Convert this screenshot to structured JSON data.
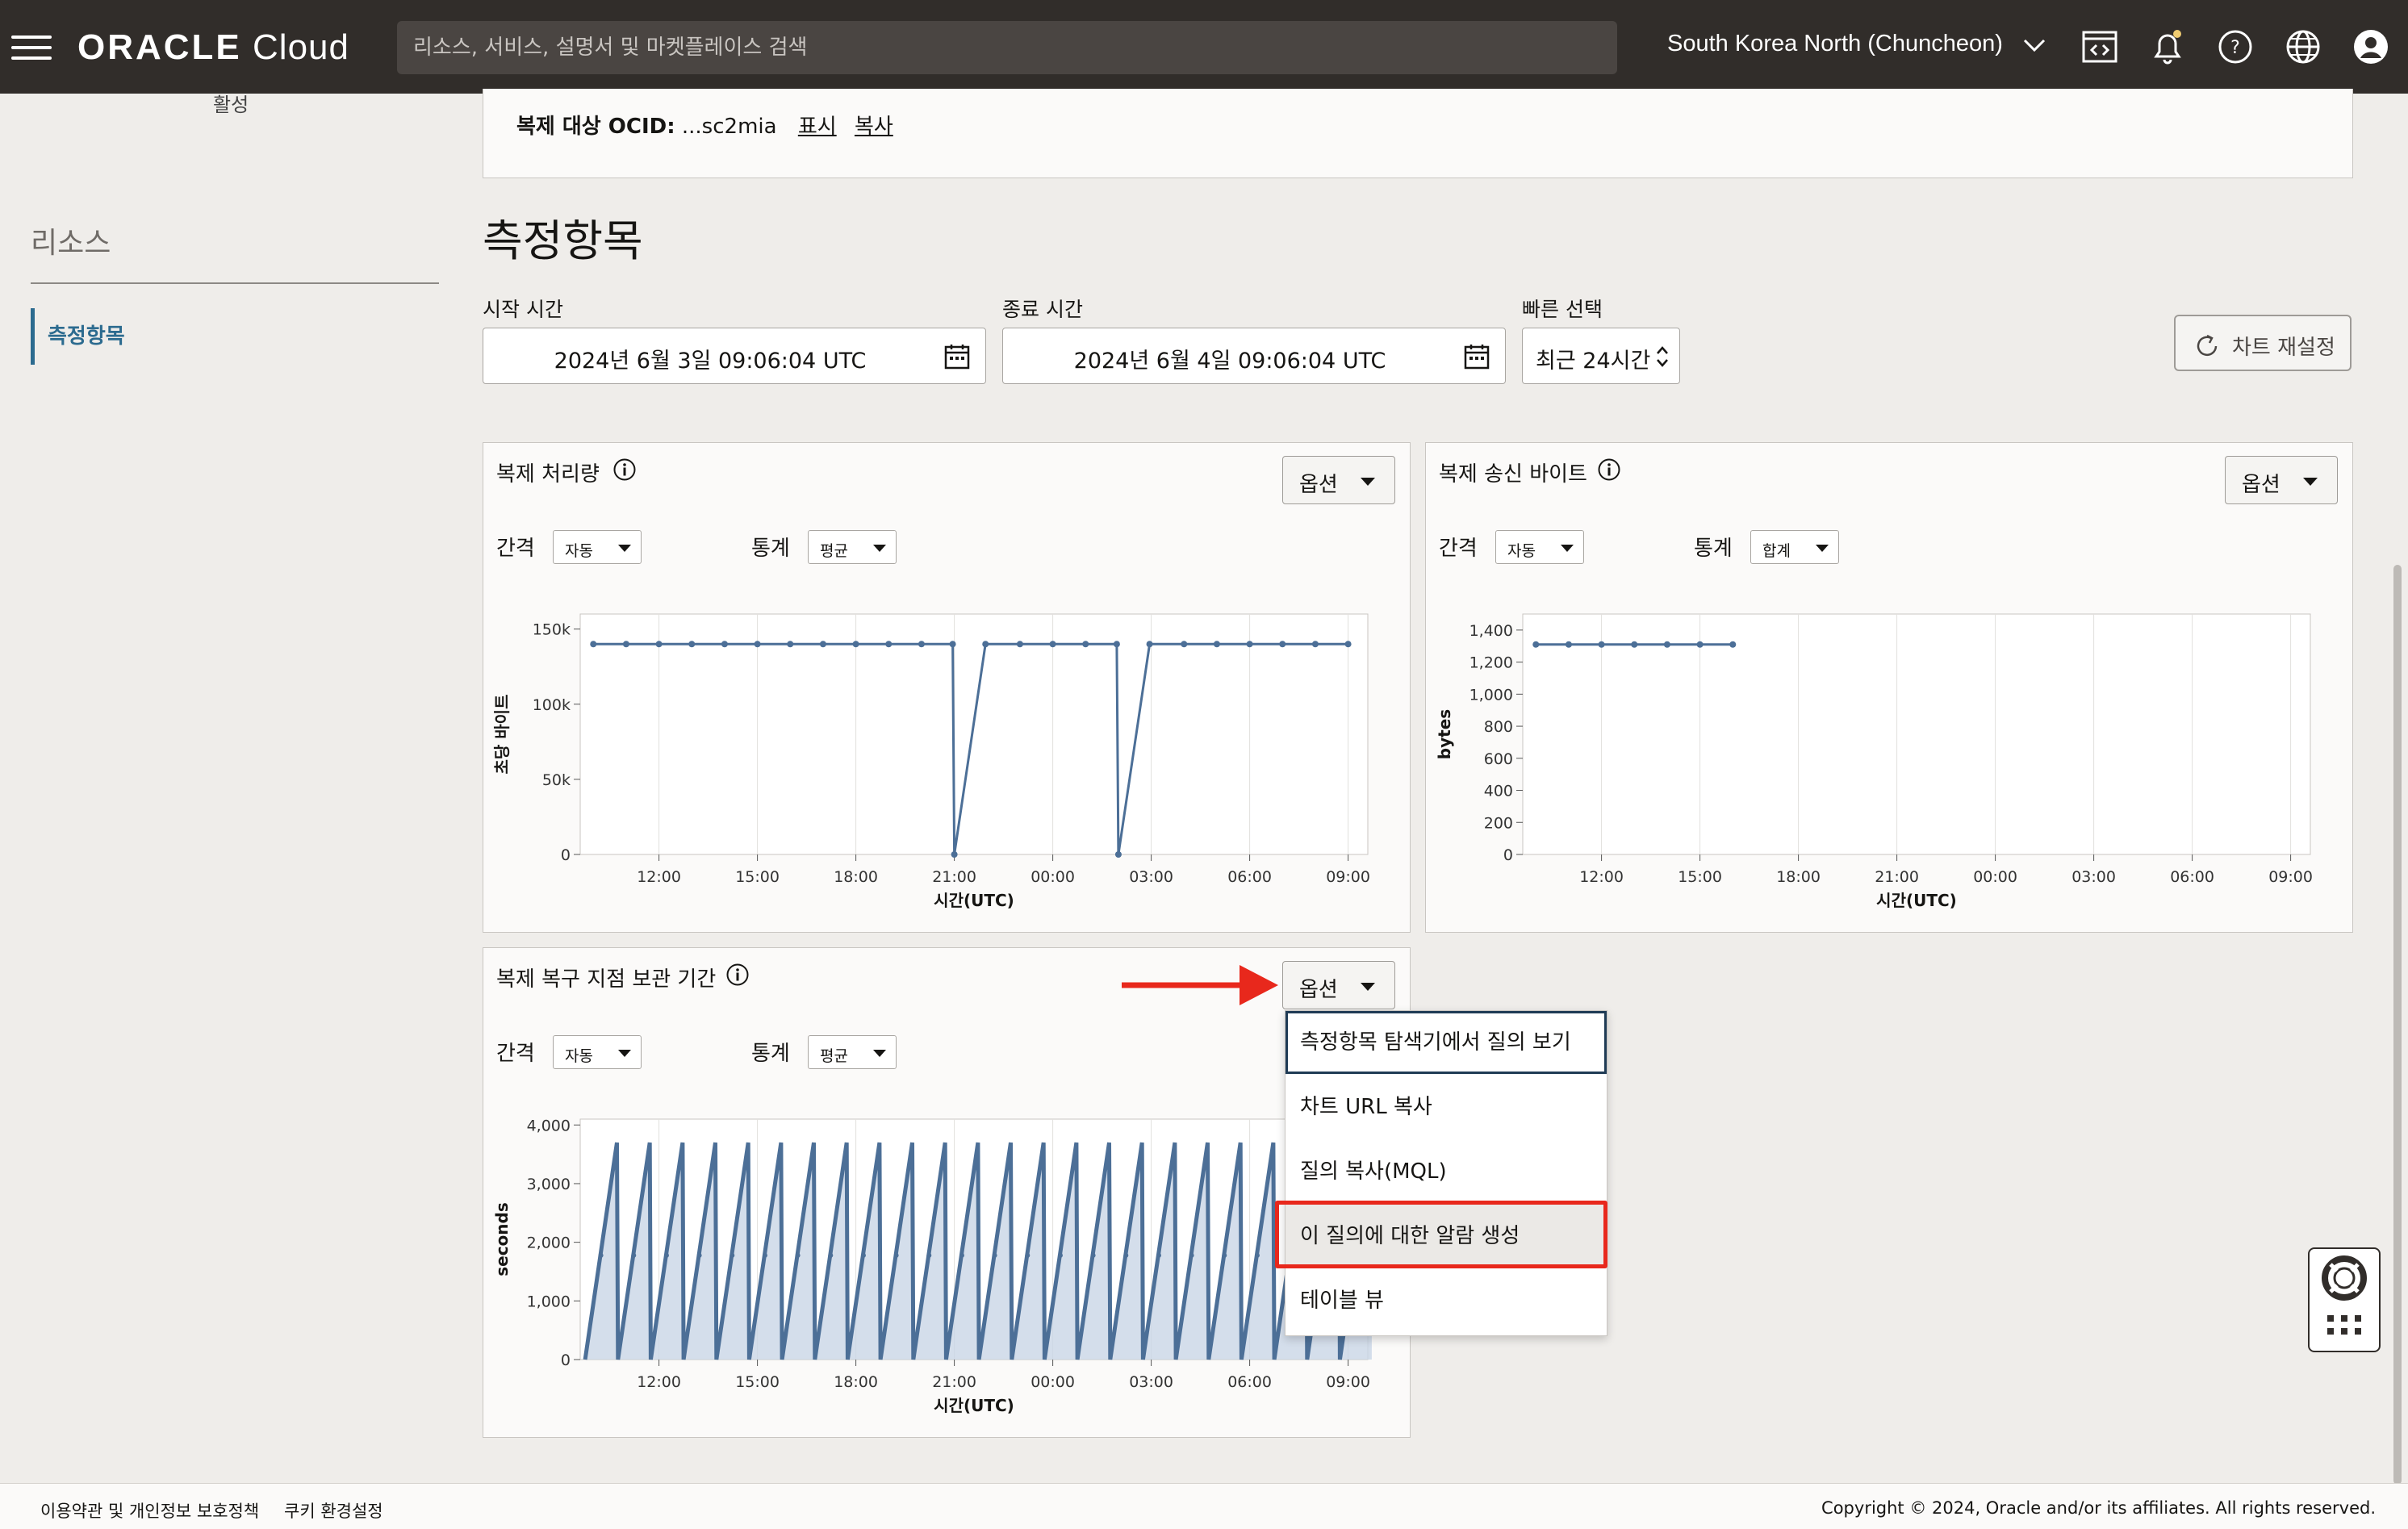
{
  "topbar": {
    "logo_brand": "ORACLE",
    "logo_product": "Cloud",
    "search_placeholder": "리소스, 서비스, 설명서 및 마켓플레이스 검색",
    "region": "South Korea North (Chuncheon)",
    "icons": [
      "menu-icon",
      "code-editor-icon",
      "bell-icon",
      "help-icon",
      "globe-icon",
      "user-icon"
    ]
  },
  "cut_text": "활성",
  "sidebar": {
    "title": "리소스",
    "items": [
      {
        "label": "측정항목",
        "active": true
      }
    ]
  },
  "detail": {
    "ocid_label": "복제 대상 OCID:",
    "ocid_value": "...sc2mia",
    "show_link": "표시",
    "copy_link": "복사"
  },
  "page_title": "측정항목",
  "filters": {
    "start_label": "시작 시간",
    "start_value": "2024년 6월 3일 09:06:04 UTC",
    "end_label": "종료 시간",
    "end_value": "2024년 6월 4일 09:06:04 UTC",
    "quick_label": "빠른 선택",
    "quick_value": "최근 24시간",
    "reset_label": "차트 재설정"
  },
  "cards": [
    {
      "title": "복제 처리량",
      "options": "옵션",
      "interval_label": "간격",
      "interval_value": "자동",
      "stat_label": "통계",
      "stat_value": "평균"
    },
    {
      "title": "복제 송신 바이트",
      "options": "옵션",
      "interval_label": "간격",
      "interval_value": "자동",
      "stat_label": "통계",
      "stat_value": "합계"
    },
    {
      "title": "복제 복구 지점 보관 기간",
      "options": "옵션",
      "interval_label": "간격",
      "interval_value": "자동",
      "stat_label": "통계",
      "stat_value": "평균"
    }
  ],
  "dropdown_menu": {
    "items": [
      "측정항목 탐색기에서 질의 보기",
      "차트 URL 복사",
      "질의 복사(MQL)",
      "이 질의에 대한 알람 생성",
      "테이블 뷰"
    ],
    "focused_index": 0,
    "highlighted_index": 3
  },
  "chart_data": [
    {
      "type": "line",
      "ylabel": "초당 바이트",
      "xlabel": "시간(UTC)",
      "xticks": [
        "12:00",
        "15:00",
        "18:00",
        "21:00",
        "00:00",
        "03:00",
        "06:00",
        "09:00"
      ],
      "yticks": [
        "0",
        "50k",
        "100k",
        "150k"
      ],
      "ylim": [
        0,
        160000
      ],
      "xlim_hours": [
        9.6,
        33.6
      ],
      "series": [
        {
          "color": "#4c6f97",
          "x": [
            10.0,
            11.0,
            12.0,
            13.0,
            14.0,
            15.0,
            16.0,
            17.0,
            18.0,
            19.0,
            20.0,
            20.95,
            21.0,
            21.95,
            23.0,
            24.0,
            25.0,
            25.95,
            26.0,
            26.95,
            28.0,
            29.0,
            30.0,
            31.0,
            32.0,
            33.0
          ],
          "y": [
            140000,
            140000,
            140000,
            140000,
            140000,
            140000,
            140000,
            140000,
            140000,
            140000,
            140000,
            140000,
            0,
            140000,
            140000,
            140000,
            140000,
            140000,
            0,
            140000,
            140000,
            140000,
            140000,
            140000,
            140000,
            140000
          ]
        }
      ]
    },
    {
      "type": "line",
      "ylabel": "bytes",
      "xlabel": "시간(UTC)",
      "xticks": [
        "12:00",
        "15:00",
        "18:00",
        "21:00",
        "00:00",
        "03:00",
        "06:00",
        "09:00"
      ],
      "yticks": [
        "0",
        "200",
        "400",
        "600",
        "800",
        "1,000",
        "1,200",
        "1,400"
      ],
      "ylim": [
        0,
        1500
      ],
      "xlim_hours": [
        9.6,
        33.6
      ],
      "series": [
        {
          "color": "#4c6f97",
          "x": [
            10,
            11,
            12,
            13,
            14,
            15,
            16
          ],
          "y": [
            1310,
            1310,
            1310,
            1310,
            1310,
            1310,
            1310
          ]
        }
      ]
    },
    {
      "type": "area",
      "ylabel": "seconds",
      "xlabel": "시간(UTC)",
      "xticks": [
        "12:00",
        "15:00",
        "18:00",
        "21:00",
        "00:00",
        "03:00",
        "06:00",
        "09:00"
      ],
      "yticks": [
        "0",
        "1,000",
        "2,000",
        "3,000",
        "4,000"
      ],
      "ylim": [
        0,
        4100
      ],
      "xlim_hours": [
        9.6,
        33.6
      ],
      "sawtooth": {
        "start_hour": 9.75,
        "period_hours": 1.0,
        "low": 0,
        "high": 3700,
        "cycles": 24
      },
      "series": [
        {
          "color": "#4c6f97"
        }
      ]
    }
  ],
  "footer": {
    "terms": "이용약관 및 개인정보 보호정책",
    "cookies": "쿠키 환경설정",
    "copyright": "Copyright © 2024, Oracle and/or its affiliates. All rights reserved."
  }
}
